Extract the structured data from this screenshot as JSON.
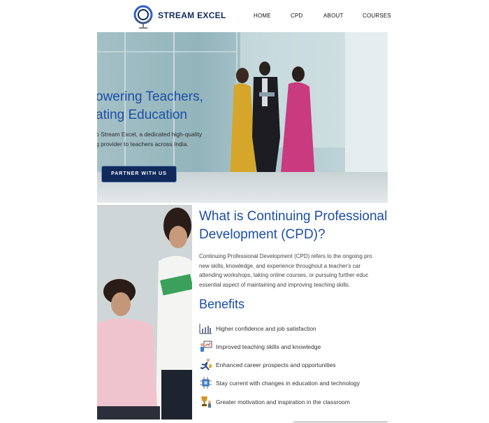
{
  "header": {
    "brand": "STREAM EXCEL",
    "nav": [
      "HOME",
      "CPD",
      "ABOUT",
      "COURSES"
    ]
  },
  "hero": {
    "title_line1": "owering Teachers,",
    "title_line2": "ating Education",
    "text_line1": "o Stream Excel, a dedicated high-quality",
    "text_line2": "g provider to teachers across India.",
    "button": "PARTNER WITH US"
  },
  "cpd": {
    "title_line1": "What is Continuing Professional",
    "title_line2": "Development (CPD)?",
    "text_lines": [
      "Continuing Professional Development (CPD) refers to the ongoing pro",
      "new skills, knowledge, and experience throughout a teacher's car",
      "attending workshops, taking online courses, or pursuing further educ",
      "essential aspect of maintaining and improving teaching skills."
    ]
  },
  "benefits": {
    "title": "Benefits",
    "items": [
      {
        "label": "Higher confidence and job satisfaction",
        "icon": "bar-chart-icon"
      },
      {
        "label": "Improved teaching skills and knowledge",
        "icon": "teacher-board-icon"
      },
      {
        "label": "Enhanced career prospects and opportunities",
        "icon": "runner-icon"
      },
      {
        "label": "Stay current with changes in education and technology",
        "icon": "chip-icon"
      },
      {
        "label": "Greater motivation and inspiration in the classroom",
        "icon": "trophy-icon"
      }
    ]
  },
  "colors": {
    "brand_navy": "#102a5c",
    "heading_blue": "#1c4ea8"
  }
}
